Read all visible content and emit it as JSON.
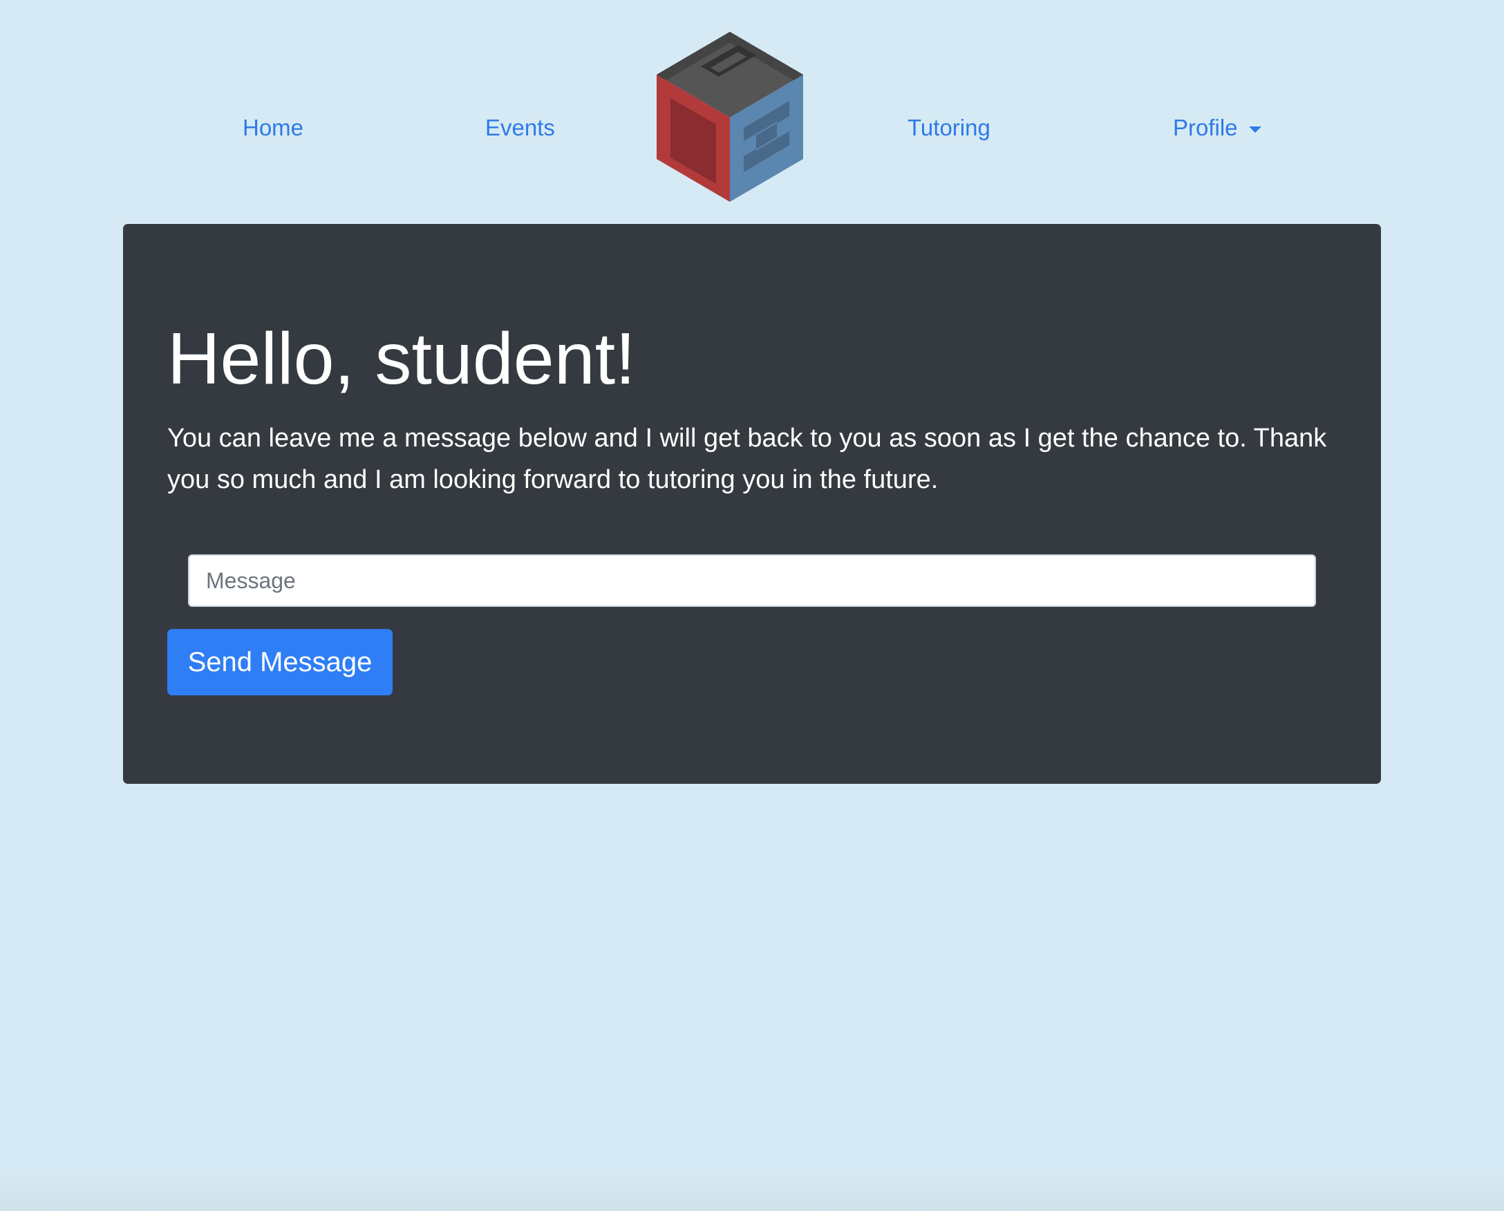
{
  "nav": {
    "items": [
      {
        "label": "Home"
      },
      {
        "label": "Events"
      },
      {
        "label": "Tutoring"
      },
      {
        "label": "Profile"
      }
    ]
  },
  "logo": {
    "icon": "pcs-cube-logo-icon",
    "colors": {
      "dark": "#555555",
      "red": "#b23a3a",
      "blue": "#5b86b0"
    }
  },
  "main": {
    "title": "Hello, student!",
    "lead": "You can leave me a message below and I will get back to you as soon as I get the chance to. Thank you so much and I am looking forward to tutoring you in the future.",
    "message_placeholder": "Message",
    "message_value": "",
    "send_label": "Send Message"
  },
  "colors": {
    "background": "#d6eaf5",
    "panel": "#343a40",
    "link": "#2f7ae5",
    "button": "#2f7ef6"
  }
}
